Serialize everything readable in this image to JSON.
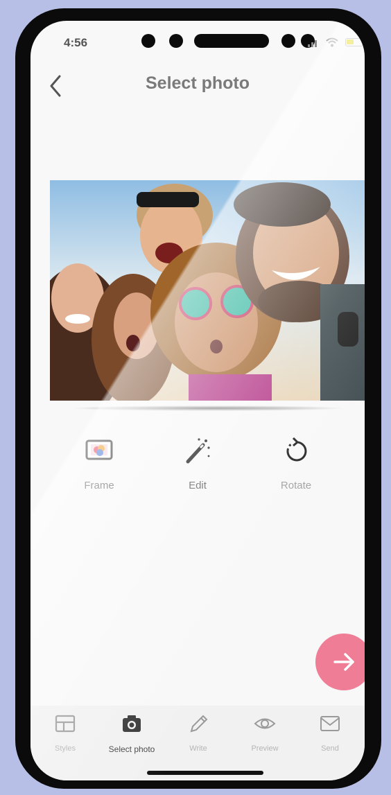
{
  "status_bar": {
    "time": "4:56"
  },
  "header": {
    "title": "Select photo"
  },
  "tools": [
    {
      "label": "Frame",
      "icon": "frame-icon"
    },
    {
      "label": "Edit",
      "icon": "magic-wand-icon"
    },
    {
      "label": "Rotate",
      "icon": "rotate-icon"
    }
  ],
  "nav": [
    {
      "label": "Styles",
      "icon": "layout-icon"
    },
    {
      "label": "Select photo",
      "icon": "camera-icon"
    },
    {
      "label": "Write",
      "icon": "pencil-icon"
    },
    {
      "label": "Preview",
      "icon": "eye-icon"
    },
    {
      "label": "Send",
      "icon": "envelope-icon"
    }
  ],
  "colors": {
    "accent": "#ee7d95",
    "background": "#b7bfe6"
  }
}
